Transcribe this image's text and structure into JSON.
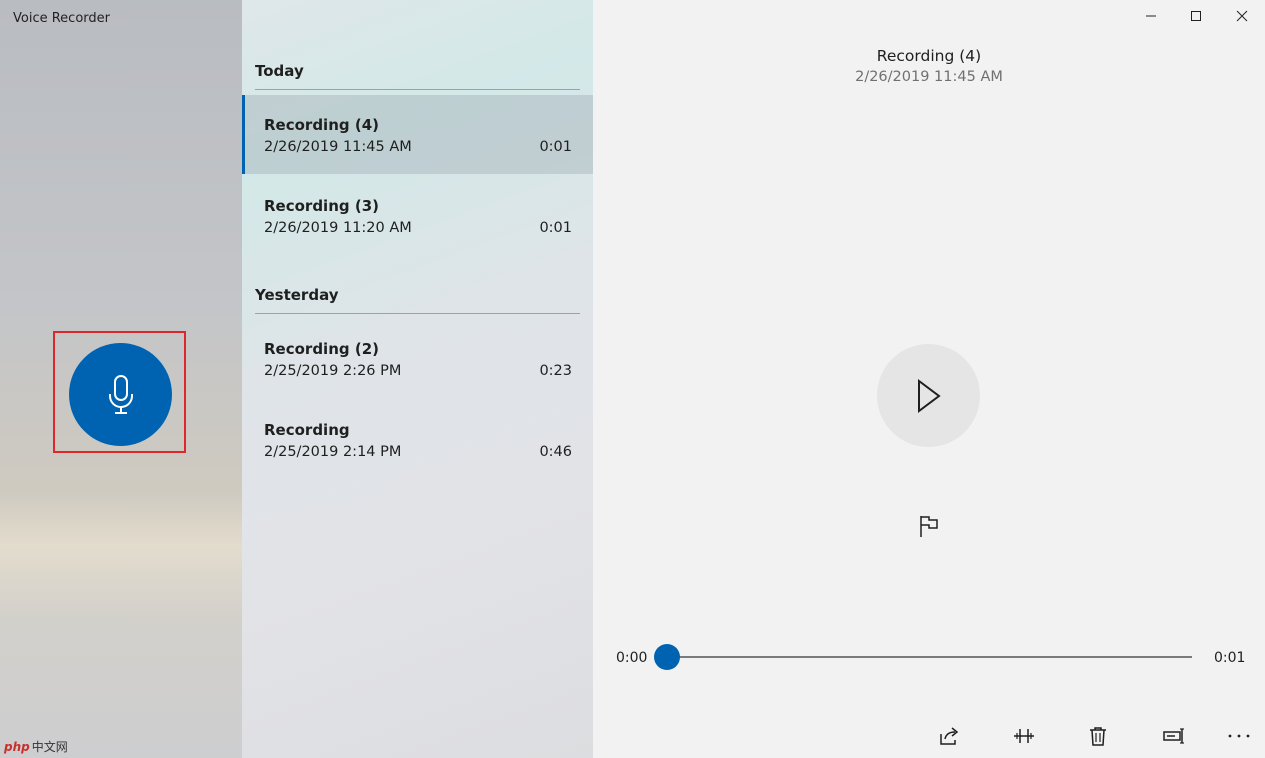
{
  "app": {
    "title": "Voice Recorder"
  },
  "groups": [
    {
      "header": "Today",
      "items": [
        {
          "name": "Recording (4)",
          "date": "2/26/2019 11:45 AM",
          "duration": "0:01",
          "selected": true
        },
        {
          "name": "Recording (3)",
          "date": "2/26/2019 11:20 AM",
          "duration": "0:01",
          "selected": false
        }
      ]
    },
    {
      "header": "Yesterday",
      "items": [
        {
          "name": "Recording (2)",
          "date": "2/25/2019 2:26 PM",
          "duration": "0:23",
          "selected": false
        },
        {
          "name": "Recording",
          "date": "2/25/2019 2:14 PM",
          "duration": "0:46",
          "selected": false
        }
      ]
    }
  ],
  "player": {
    "title": "Recording (4)",
    "date": "2/26/2019 11:45 AM",
    "time_start": "0:00",
    "time_end": "0:01",
    "progress": 0.0
  },
  "toolbar": {
    "icons": [
      "share-icon",
      "trim-icon",
      "delete-icon",
      "rename-icon",
      "more-icon"
    ]
  },
  "watermark": {
    "brand": "php",
    "rest": "中文网"
  },
  "colors": {
    "accent": "#0063b1",
    "highlight_border": "#e0262b"
  }
}
